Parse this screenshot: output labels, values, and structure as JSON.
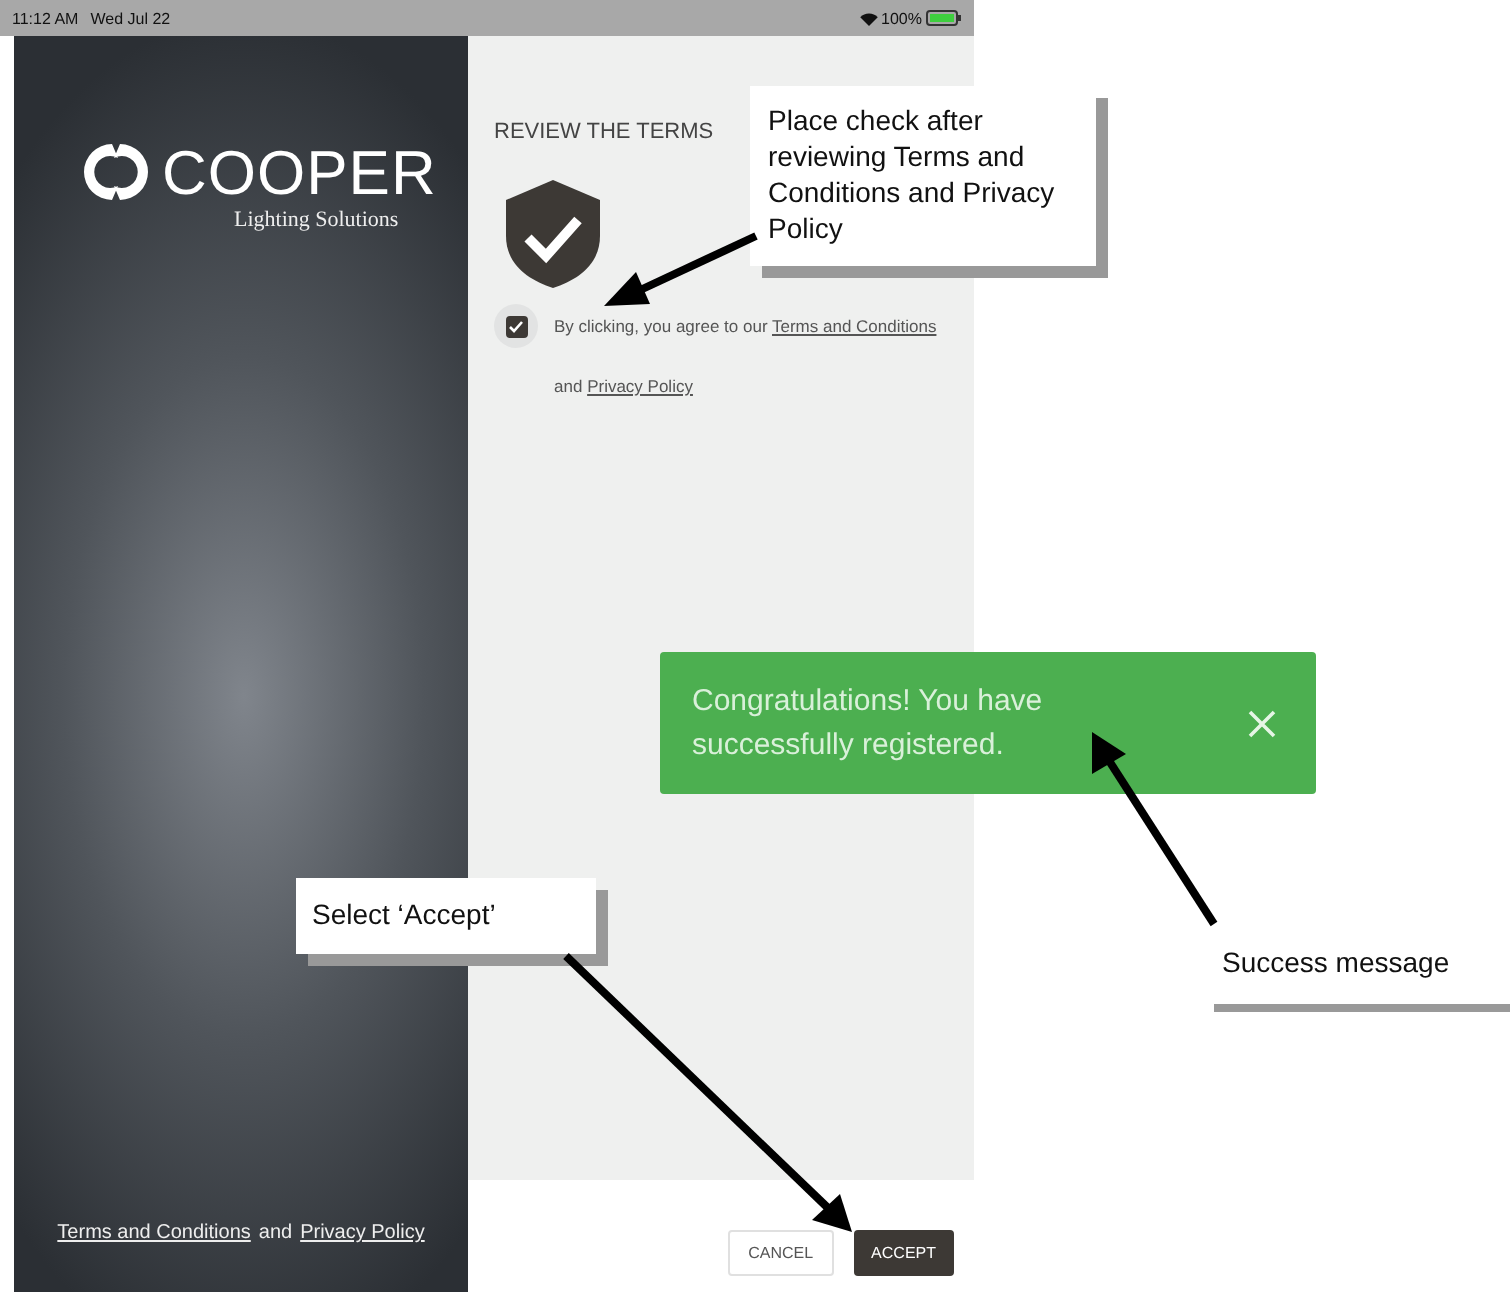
{
  "status_bar": {
    "time": "11:12 AM",
    "date": "Wed Jul 22",
    "battery": "100%"
  },
  "brand": {
    "name": "COOPER",
    "tagline": "Lighting Solutions"
  },
  "sidebar_footer": {
    "link_1": "Terms and Conditions",
    "joiner": "and",
    "link_2": "Privacy Policy"
  },
  "terms": {
    "heading": "REVIEW THE TERMS",
    "agree": {
      "checked": true,
      "prefix": "By clicking, you agree to our",
      "link_1": "Terms and Conditions",
      "joiner": "and",
      "link_2": "Privacy Policy"
    }
  },
  "buttons": [
    {
      "label": "CANCEL",
      "kind": "secondary"
    },
    {
      "label": "ACCEPT",
      "kind": "primary"
    }
  ],
  "toast": {
    "message": "Congratulations! You have successfully registered."
  },
  "callouts": [
    {
      "text": "Place check after reviewing Terms and Conditions and Privacy Policy",
      "kind": "shadowed"
    },
    {
      "text": "Select ‘Accept’",
      "kind": "shadowed"
    },
    {
      "text": "Success message",
      "kind": "underlined"
    }
  ]
}
